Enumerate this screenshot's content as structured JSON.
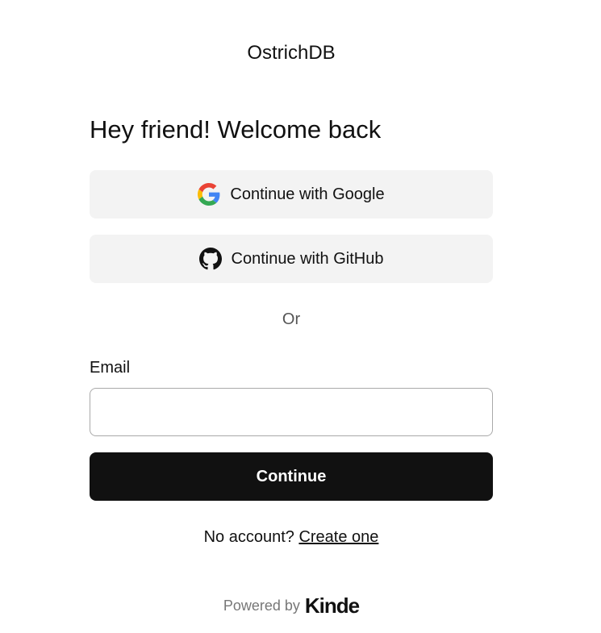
{
  "brand": {
    "name": "OstrichDB"
  },
  "heading": "Hey friend! Welcome back",
  "social": {
    "google_label": "Continue with Google",
    "google_icon": "google-icon",
    "github_label": "Continue with GitHub",
    "github_icon": "github-icon"
  },
  "divider_text": "Or",
  "email": {
    "label": "Email",
    "value": "",
    "placeholder": ""
  },
  "continue_label": "Continue",
  "signup": {
    "prompt": "No account? ",
    "link_text": "Create one"
  },
  "footer": {
    "powered_by": "Powered by",
    "provider": "Kinde"
  },
  "colors": {
    "primary_button": "#111111",
    "social_button_bg": "#f3f3f3",
    "input_border": "#a9a9a9"
  }
}
